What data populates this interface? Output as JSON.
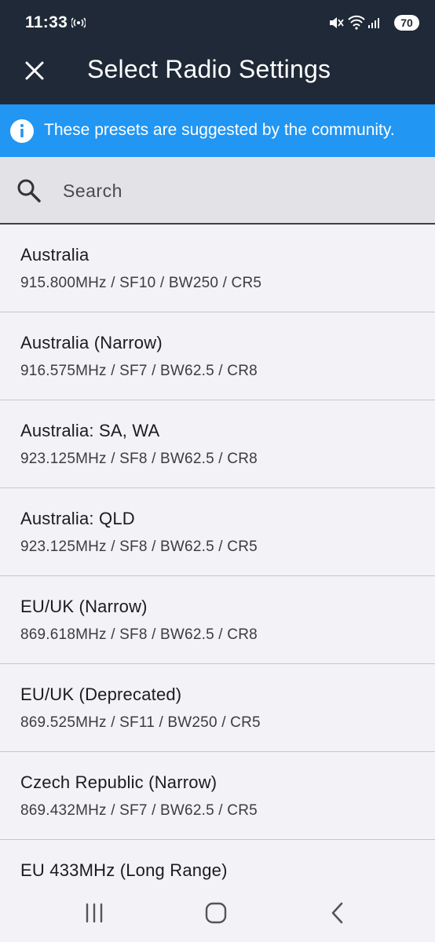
{
  "status_bar": {
    "time": "11:33",
    "battery": "70"
  },
  "app_bar": {
    "title": "Select Radio Settings"
  },
  "info_banner": {
    "text": "These presets are suggested by the community."
  },
  "search": {
    "placeholder": "Search"
  },
  "presets": [
    {
      "name": "Australia",
      "detail": "915.800MHz / SF10 / BW250 / CR5"
    },
    {
      "name": "Australia (Narrow)",
      "detail": "916.575MHz / SF7 / BW62.5 / CR8"
    },
    {
      "name": "Australia: SA, WA",
      "detail": "923.125MHz / SF8 / BW62.5 / CR8"
    },
    {
      "name": "Australia: QLD",
      "detail": "923.125MHz / SF8 / BW62.5 / CR5"
    },
    {
      "name": "EU/UK (Narrow)",
      "detail": "869.618MHz / SF8 / BW62.5 / CR8"
    },
    {
      "name": "EU/UK (Deprecated)",
      "detail": "869.525MHz / SF11 / BW250 / CR5"
    },
    {
      "name": "Czech Republic (Narrow)",
      "detail": "869.432MHz / SF7 / BW62.5 / CR5"
    },
    {
      "name": "EU 433MHz (Long Range)",
      "detail": ""
    }
  ],
  "colors": {
    "header_bg": "#1f2937",
    "banner_bg": "#2196f3",
    "list_bg": "#f2f2f7"
  }
}
